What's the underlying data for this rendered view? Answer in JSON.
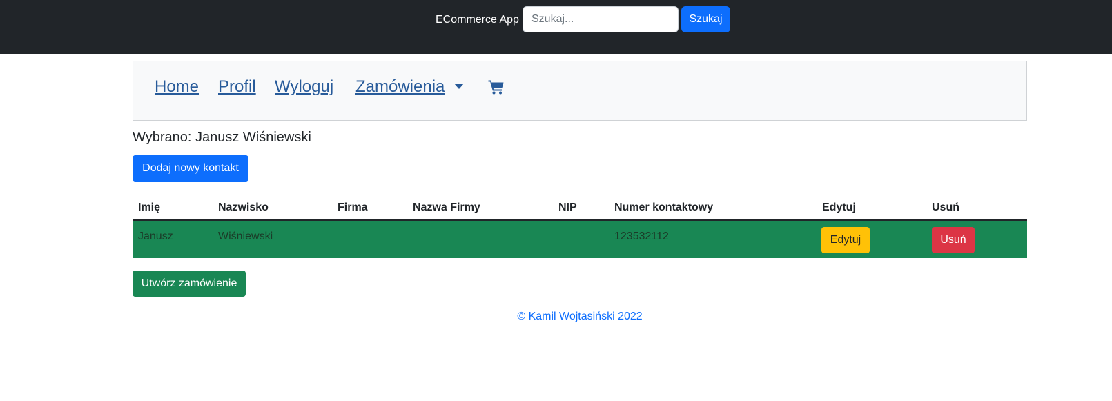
{
  "header": {
    "brand": "ECommerce App",
    "search_placeholder": "Szukaj...",
    "search_value": "",
    "search_button": "Szukaj",
    "background_color": "#212529"
  },
  "nav": {
    "items": [
      {
        "label": "Home"
      },
      {
        "label": "Profil"
      },
      {
        "label": "Wyloguj"
      },
      {
        "label": "Zamówienia"
      }
    ],
    "cart_icon": "shopping-cart-icon",
    "dropdown_icon": "caret-down-icon",
    "link_color": "#285b9a"
  },
  "main": {
    "selected_text": "Wybrano: Janusz Wiśniewski",
    "add_contact_button": "Dodaj nowy kontakt",
    "create_order_button": "Utwórz zamówienie"
  },
  "table": {
    "headers": [
      "Imię",
      "Nazwisko",
      "Firma",
      "Nazwa Firmy",
      "NIP",
      "Numer kontaktowy",
      "Edytuj",
      "Usuń"
    ],
    "rows": [
      {
        "first_name": "Janusz",
        "last_name": "Wiśniewski",
        "company": "",
        "company_name": "",
        "nip": "",
        "phone": "123532112",
        "edit_label": "Edytuj",
        "delete_label": "Usuń"
      }
    ],
    "selected_row_color": "#198754"
  },
  "footer": {
    "text": "© Kamil Wojtasiński 2022"
  },
  "colors": {
    "primary": "#0d6efd",
    "success": "#198754",
    "warning": "#ffc107",
    "danger": "#dc3545"
  }
}
